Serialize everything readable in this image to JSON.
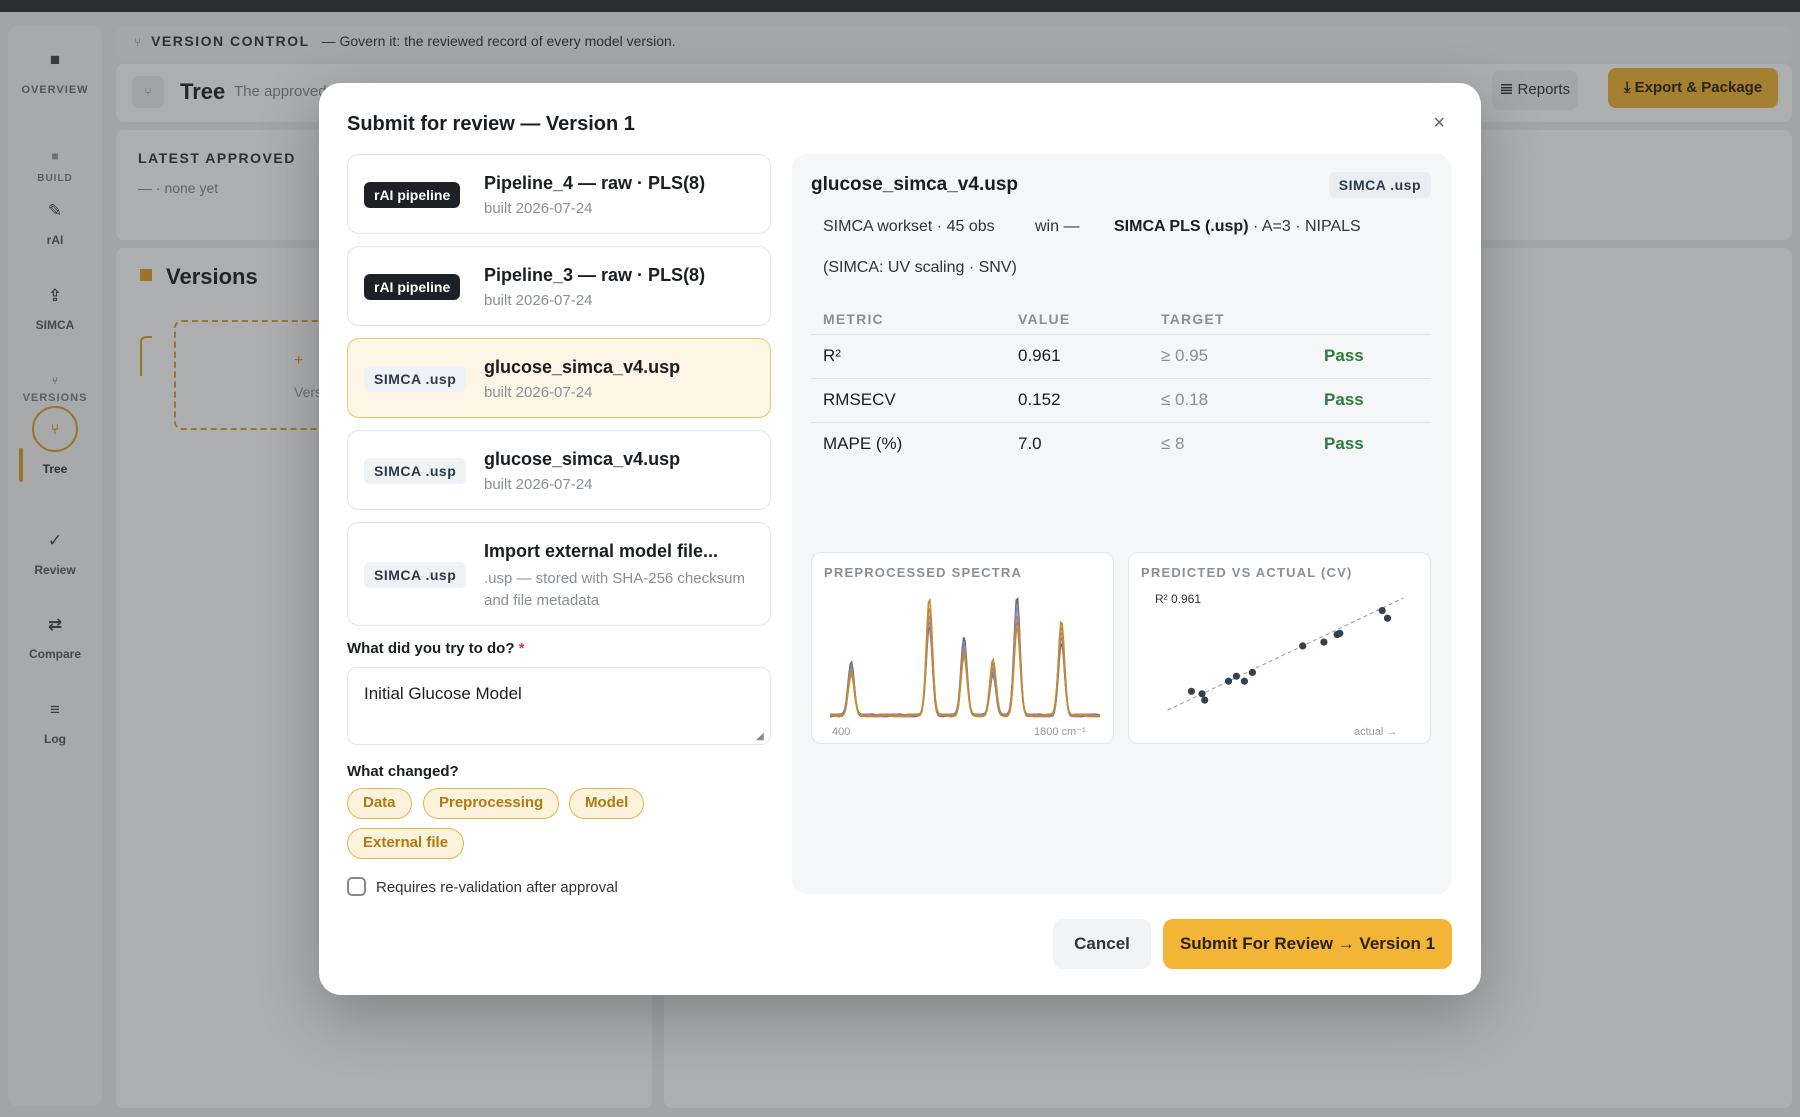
{
  "background": {
    "rail": {
      "overview_label": "OVERVIEW",
      "build_label": "BUILD",
      "rai_label": "rAI",
      "simca_label": "SIMCA",
      "versions_label": "VERSIONS",
      "tree_label": "Tree",
      "review_label": "Review",
      "compare_label": "Compare",
      "log_label": "Log"
    },
    "version_control": {
      "title": "VERSION CONTROL",
      "subtitle": "— Govern it: the reviewed record of every model version."
    },
    "header": {
      "title": "Tree",
      "subtitle": "The approved",
      "reports_label": "Reports",
      "export_label": "Export & Package"
    },
    "latest_approved": {
      "label": "LATEST APPROVED",
      "value": "— · none yet"
    },
    "versions": {
      "title": "Versions",
      "add_label": "+",
      "add_sub": "Vers"
    }
  },
  "modal": {
    "title": "Submit for review — Version 1",
    "close_symbol": "×",
    "options": [
      {
        "badge": "rAI pipeline",
        "name": "Pipeline_4 — raw · PLS(8)",
        "sub": "built 2026-07-24"
      },
      {
        "badge": "rAI pipeline",
        "name": "Pipeline_3 — raw · PLS(8)",
        "sub": "built 2026-07-24"
      },
      {
        "badge": "SIMCA .usp",
        "name": "glucose_simca_v4.usp",
        "sub": "built 2026-07-24"
      },
      {
        "badge": "SIMCA .usp",
        "name": "glucose_simca_v4.usp",
        "sub": "built 2026-07-24"
      },
      {
        "badge": "SIMCA .usp",
        "name": "Import external model file...",
        "sub": ".usp — stored with SHA-256 checksum and file metadata"
      }
    ],
    "goal_label": "What did you try to do?",
    "goal_required": "*",
    "goal_value": "Initial Glucose Model",
    "changed_label": "What changed?",
    "chips": [
      "Data",
      "Preprocessing",
      "Model",
      "External file"
    ],
    "revalidation_label": "Requires re-validation after approval",
    "preview": {
      "file_name": "glucose_simca_v4.usp",
      "badge": "SIMCA .usp",
      "meta": "SIMCA workset · 45 obs",
      "win": "win —",
      "model_bold": "SIMCA PLS (.usp)",
      "model_rest": " · A=3 · NIPALS",
      "note": "(SIMCA: UV scaling · SNV)",
      "table": {
        "headers": [
          "METRIC",
          "VALUE",
          "TARGET",
          ""
        ],
        "rows": [
          {
            "metric": "R²",
            "value": "0.961",
            "target": "≥ 0.95",
            "status": "Pass"
          },
          {
            "metric": "RMSECV",
            "value": "0.152",
            "target": "≤ 0.18",
            "status": "Pass"
          },
          {
            "metric": "MAPE (%)",
            "value": "7.0",
            "target": "≤ 8",
            "status": "Pass"
          }
        ]
      }
    },
    "cancel_label": "Cancel",
    "submit_label": "Submit For Review → Version  1"
  },
  "chart_data": [
    {
      "type": "line",
      "title": "PREPROCESSED SPECTRA",
      "x_tick_labels": [
        "400",
        "1800 cm⁻¹"
      ],
      "xlim": [
        400,
        1800
      ],
      "peaks": [
        {
          "x": 510,
          "height": 0.45
        },
        {
          "x": 915,
          "height": 0.98
        },
        {
          "x": 1095,
          "height": 0.66
        },
        {
          "x": 1245,
          "height": 0.46
        },
        {
          "x": 1370,
          "height": 0.99
        },
        {
          "x": 1600,
          "height": 0.8
        }
      ],
      "series_count": 5,
      "colors": [
        "#5b6b73",
        "#7d86b8",
        "#c9748a",
        "#9a8f5a",
        "#c98a2a"
      ]
    },
    {
      "type": "scatter",
      "title": "PREDICTED VS ACTUAL (CV)",
      "annotation": "R² 0.961",
      "x_tick_labels": [
        "actual →"
      ],
      "xlim": [
        0,
        10
      ],
      "ylim": [
        0,
        10
      ],
      "points": [
        {
          "x": 1.6,
          "y": 2.2
        },
        {
          "x": 2.0,
          "y": 2.0
        },
        {
          "x": 2.1,
          "y": 1.5
        },
        {
          "x": 3.0,
          "y": 3.0
        },
        {
          "x": 3.3,
          "y": 3.4
        },
        {
          "x": 3.6,
          "y": 3.0
        },
        {
          "x": 3.9,
          "y": 3.7
        },
        {
          "x": 5.8,
          "y": 5.8
        },
        {
          "x": 6.6,
          "y": 6.1
        },
        {
          "x": 7.1,
          "y": 6.7
        },
        {
          "x": 7.2,
          "y": 6.8
        },
        {
          "x": 8.8,
          "y": 8.6
        },
        {
          "x": 9.0,
          "y": 8.0
        }
      ],
      "point_color": "#36414e"
    }
  ]
}
